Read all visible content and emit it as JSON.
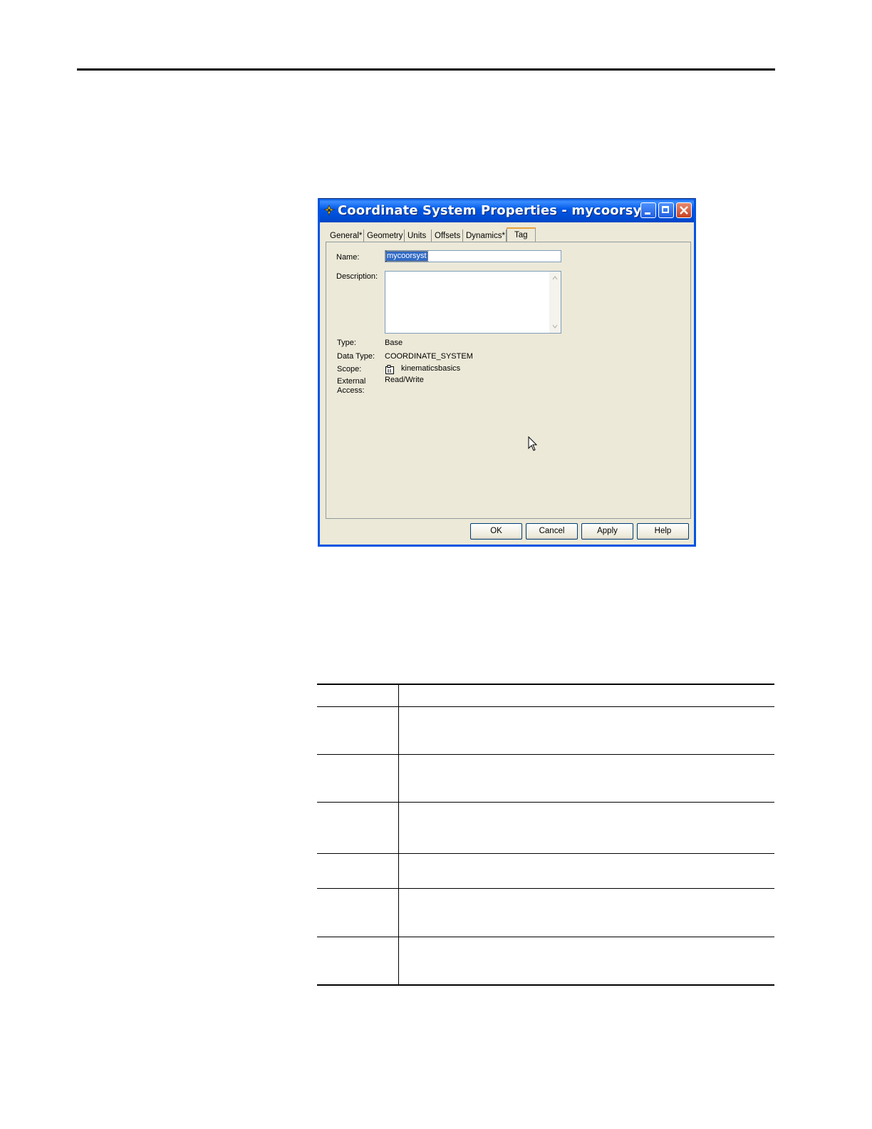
{
  "dialog": {
    "title": "Coordinate System Properties - mycoorsyst",
    "tabs": [
      "General*",
      "Geometry",
      "Units",
      "Offsets",
      "Dynamics*",
      "Tag"
    ],
    "active_tab": "Tag",
    "fields": {
      "name_label": "Name:",
      "name_value": "mycoorsyst",
      "description_label": "Description:",
      "description_value": "",
      "type_label": "Type:",
      "type_value": "Base",
      "data_type_label": "Data Type:",
      "data_type_value": "COORDINATE_SYSTEM",
      "scope_label": "Scope:",
      "scope_value": "kinematicsbasics",
      "external_access_label_1": "External",
      "external_access_label_2": "Access:",
      "external_access_value": "Read/Write"
    },
    "buttons": {
      "ok": "OK",
      "cancel": "Cancel",
      "apply": "Apply",
      "help": "Help"
    }
  },
  "colors": {
    "titlebar": "#0058e6",
    "dialog_bg": "#ece9d8",
    "selection": "#316ac5"
  }
}
